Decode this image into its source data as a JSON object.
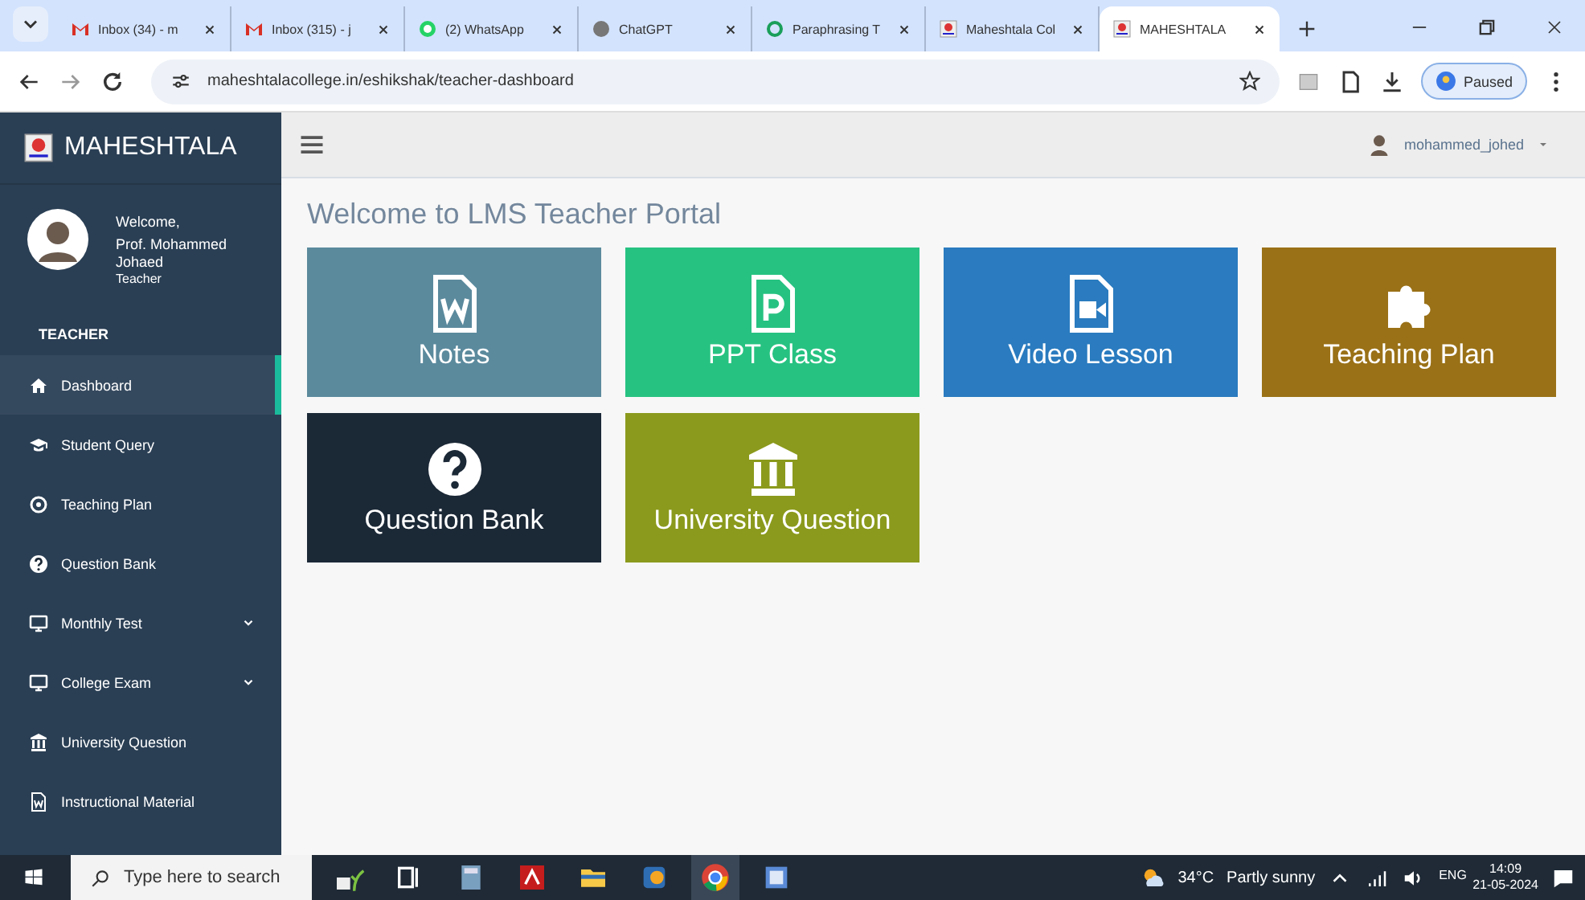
{
  "browser": {
    "tabs": [
      {
        "title": "Inbox (34) - m",
        "kind": "mail",
        "selected": false
      },
      {
        "title": "Inbox (315) - j",
        "kind": "mail",
        "selected": false
      },
      {
        "title": "(2) WhatsApp",
        "kind": "chat",
        "selected": false
      },
      {
        "title": "ChatGPT",
        "kind": "circle",
        "selected": false
      },
      {
        "title": "Paraphrasing T",
        "kind": "ring",
        "selected": false
      },
      {
        "title": "Maheshtala Col",
        "kind": "logo",
        "selected": false
      },
      {
        "title": "MAHESHTALA",
        "kind": "logo",
        "selected": true
      }
    ],
    "url": "maheshtalacollege.in/eshikshak/teacher-dashboard",
    "profile": "Paused"
  },
  "sidebar": {
    "brand": "MAHESHTALA",
    "welcome": "Welcome,",
    "name": "Prof. Mohammed Johaed",
    "role": "Teacher",
    "section": "TEACHER",
    "items": [
      {
        "label": "Dashboard",
        "kind": "home",
        "selected": true,
        "has_submenu": false
      },
      {
        "label": "Student Query",
        "kind": "cap",
        "selected": false,
        "has_submenu": false
      },
      {
        "label": "Teaching Plan",
        "kind": "target",
        "selected": false,
        "has_submenu": false
      },
      {
        "label": "Question Bank",
        "kind": "question",
        "selected": false,
        "has_submenu": false
      },
      {
        "label": "Monthly Test",
        "kind": "monitor",
        "selected": false,
        "has_submenu": true
      },
      {
        "label": "College Exam",
        "kind": "monitor",
        "selected": false,
        "has_submenu": true
      },
      {
        "label": "University Question",
        "kind": "bank",
        "selected": false,
        "has_submenu": false
      },
      {
        "label": "Instructional Material",
        "kind": "docw",
        "selected": false,
        "has_submenu": false
      }
    ]
  },
  "topbar": {
    "user": "mohammed_johed"
  },
  "title": "Welcome to LMS Teacher Portal",
  "tiles": [
    {
      "label": "Notes",
      "kind": "docw",
      "color": "#5b8a9d"
    },
    {
      "label": "PPT Class",
      "kind": "docp",
      "color": "#26c281"
    },
    {
      "label": "Video Lesson",
      "kind": "video",
      "color": "#2a7bbf"
    },
    {
      "label": "Teaching Plan",
      "kind": "puzzle",
      "color": "#9a7117"
    },
    {
      "label": "Question Bank",
      "kind": "question",
      "color": "#1b2836"
    },
    {
      "label": "University Question",
      "kind": "bank",
      "color": "#8b9a1c"
    }
  ],
  "taskbar": {
    "search_placeholder": "Type here to search",
    "temperature": "34°C",
    "weather": "Partly sunny",
    "language": "ENG",
    "time": "14:09",
    "date": "21-05-2024"
  }
}
